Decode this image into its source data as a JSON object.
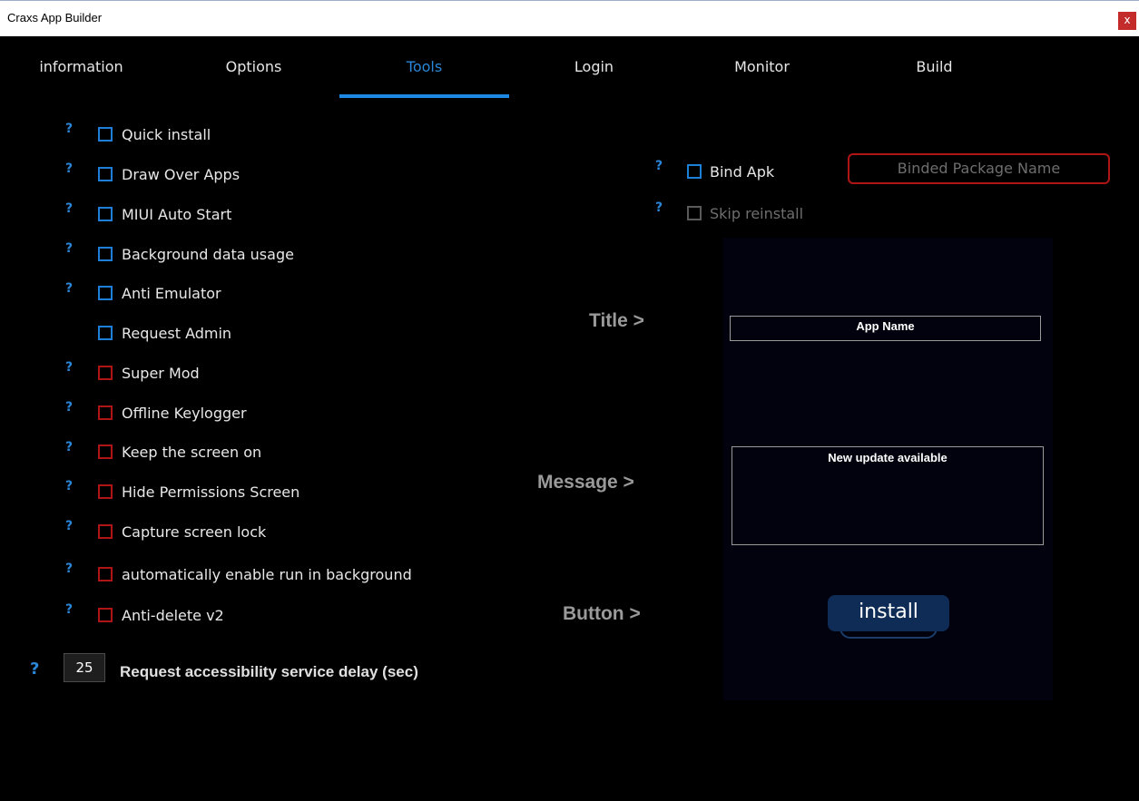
{
  "window": {
    "title": "Craxs App Builder",
    "close_glyph": "x"
  },
  "tabs": [
    {
      "label": "information"
    },
    {
      "label": "Options"
    },
    {
      "label": "Tools"
    },
    {
      "label": "Login"
    },
    {
      "label": "Monitor"
    },
    {
      "label": "Build"
    }
  ],
  "active_tab": "Tools",
  "help_glyph": "?",
  "options": [
    {
      "label": "Quick install",
      "checked": false,
      "color": "#1e7fd8"
    },
    {
      "label": "Draw Over Apps",
      "checked": false,
      "color": "#1e7fd8"
    },
    {
      "label": "MIUI Auto Start",
      "checked": false,
      "color": "#1e7fd8"
    },
    {
      "label": "Background data usage",
      "checked": false,
      "color": "#1e7fd8"
    },
    {
      "label": "Anti Emulator",
      "checked": false,
      "color": "#1e7fd8"
    },
    {
      "label": "Request Admin",
      "checked": false,
      "color": "#1e7fd8"
    },
    {
      "label": "Super Mod",
      "checked": false,
      "color": "#b01515"
    },
    {
      "label": "Offline Keylogger",
      "checked": false,
      "color": "#b01515"
    },
    {
      "label": "Keep the screen on",
      "checked": false,
      "color": "#b01515"
    },
    {
      "label": "Hide Permissions Screen",
      "checked": false,
      "color": "#b01515"
    },
    {
      "label": "Capture screen lock",
      "checked": false,
      "color": "#b01515"
    },
    {
      "label": "automatically enable run in background",
      "checked": false,
      "color": "#b01515"
    },
    {
      "label": "Anti-delete v2",
      "checked": false,
      "color": "#b01515"
    }
  ],
  "accessibility_delay": {
    "value": "25",
    "label": "Request accessibility service delay (sec)"
  },
  "bind": {
    "bind_apk_label": "Bind Apk",
    "skip_reinstall_label": "Skip reinstall",
    "package_placeholder": "Binded Package Name"
  },
  "preview": {
    "title_label": "Title >",
    "message_label": "Message >",
    "button_label": "Button >",
    "title_value": "App Name",
    "message_value": "New update available",
    "button_value": "install"
  },
  "colors": {
    "accent": "#1e88e5",
    "danger": "#b01515",
    "background": "#000000",
    "preview_bg": "#02020f",
    "install_button": "#0e2c55"
  }
}
